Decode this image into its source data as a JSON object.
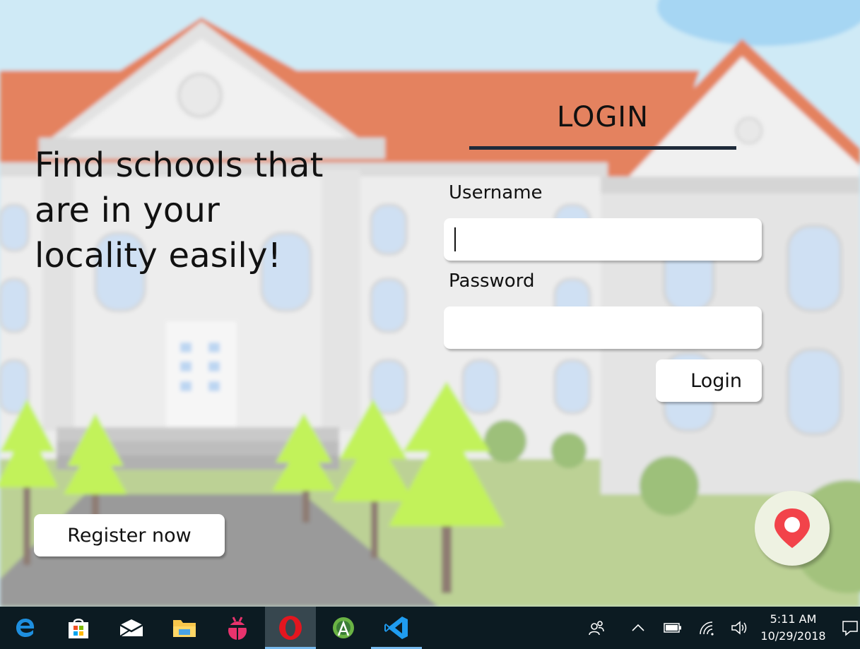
{
  "tagline": "Find schools that are in your locality easily!",
  "login": {
    "heading": "LOGIN",
    "username_label": "Username",
    "username_value": "",
    "password_label": "Password",
    "password_value": "",
    "submit_label": "Login"
  },
  "register_label": "Register now",
  "location_button": {
    "icon": "map-pin-icon",
    "color": "#f2434a"
  },
  "taskbar": {
    "apps": [
      {
        "name": "Microsoft Edge",
        "icon": "edge-icon"
      },
      {
        "name": "Microsoft Store",
        "icon": "store-icon"
      },
      {
        "name": "Mail",
        "icon": "mail-icon"
      },
      {
        "name": "File Explorer",
        "icon": "folder-icon"
      },
      {
        "name": "App",
        "icon": "bug-icon"
      },
      {
        "name": "Opera",
        "icon": "opera-icon",
        "active": true
      },
      {
        "name": "Android Studio",
        "icon": "android-studio-icon"
      },
      {
        "name": "Visual Studio Code",
        "icon": "vscode-icon",
        "running": true
      }
    ],
    "tray": [
      "people-icon",
      "chevron-up-icon",
      "battery-icon",
      "wifi-icon",
      "volume-icon"
    ],
    "time": "5:11 AM",
    "date": "10/29/2018",
    "notification_icon": "notification-icon"
  },
  "colors": {
    "accent_underline": "#1e2a3a",
    "taskbar_bg": "#0c1b22",
    "sky": "#cfeaf6",
    "roof": "#e4825f",
    "grass": "#b7cd8e",
    "tree": "#c2f25a"
  }
}
